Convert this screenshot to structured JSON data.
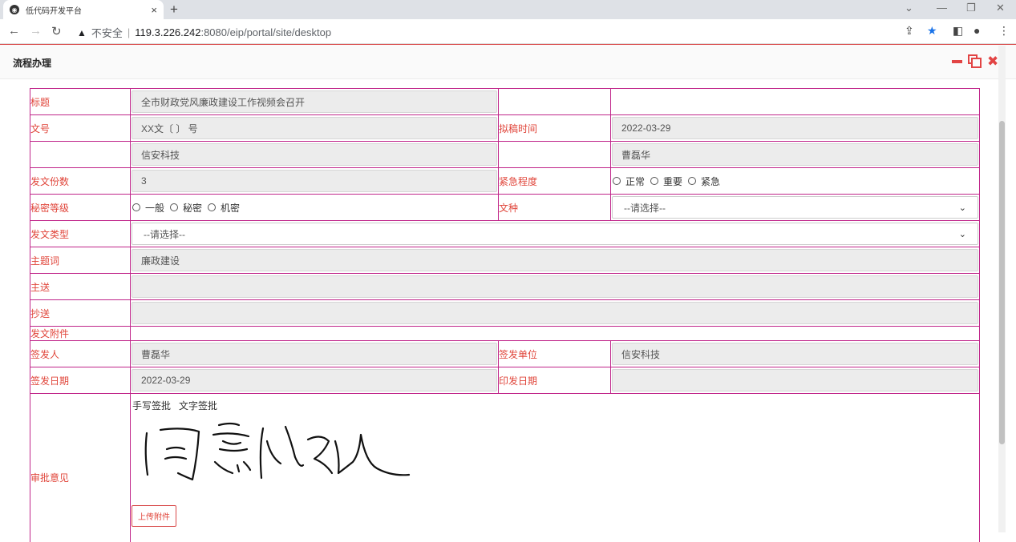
{
  "browser": {
    "tab_title": "低代码开发平台",
    "tab_close": "×",
    "new_tab": "+",
    "insecure_label": "不安全",
    "url_host": "119.3.226.242",
    "url_path": ":8080/eip/portal/site/desktop"
  },
  "dialog": {
    "title": "流程办理"
  },
  "form": {
    "title_label": "标题",
    "title_value": "全市财政党风廉政建设工作视频会召开",
    "docno_label": "文号",
    "docno_value": "XX文〔  〕 号",
    "draft_time_label": "拟稿时间",
    "draft_time_value": "2022-03-29",
    "org_value": "信安科技",
    "person_value": "曹磊华",
    "copies_label": "发文份数",
    "copies_value": "3",
    "urgency_label": "紧急程度",
    "urgency_options": [
      "正常",
      "重要",
      "紧急"
    ],
    "secret_label": "秘密等级",
    "secret_options": [
      "一般",
      "秘密",
      "机密"
    ],
    "doctype_label": "文种",
    "doctype_value": "--请选择--",
    "sendtype_label": "发文类型",
    "sendtype_value": "--请选择--",
    "keyword_label": "主题词",
    "keyword_value": "廉政建设",
    "to_label": "主送",
    "to_value": "",
    "cc_label": "抄送",
    "cc_value": "",
    "attach_label": "发文附件",
    "signer_label": "签发人",
    "signer_value": "曹磊华",
    "sign_unit_label": "签发单位",
    "sign_unit_value": "信安科技",
    "sign_date_label": "签发日期",
    "sign_date_value": "2022-03-29",
    "print_date_label": "印发日期",
    "print_date_value": "",
    "approve_label": "审批意见",
    "handwrite_link": "手写签批",
    "text_link": "文字签批",
    "upload_label": "上传附件"
  }
}
